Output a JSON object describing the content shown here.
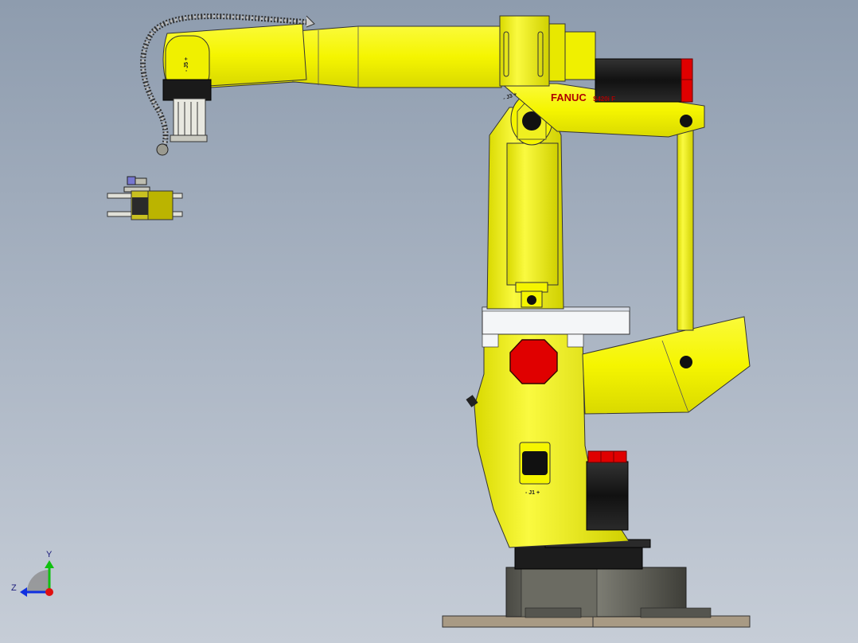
{
  "viewport": {
    "background_top": "#8e9cae",
    "background_bottom": "#c6cdd7"
  },
  "robot": {
    "brand": "FANUC",
    "model": "S420i F",
    "joint_labels": {
      "j5": "- J5 +",
      "j3": "- J3 +",
      "j1": "- J1 +"
    },
    "body_color": "#f5f500",
    "shade_color": "#d6d600",
    "brand_color": "#b00000",
    "stop_color": "#e00000",
    "motor_color": "#1a1a1a"
  },
  "triad": {
    "axis_y": "Y",
    "axis_z": "Z",
    "y_color": "#10c010",
    "z_color": "#1030e0",
    "origin_color": "#e01010"
  },
  "icons": {
    "gripper": "gripper-icon",
    "triad": "axis-triad-icon"
  }
}
